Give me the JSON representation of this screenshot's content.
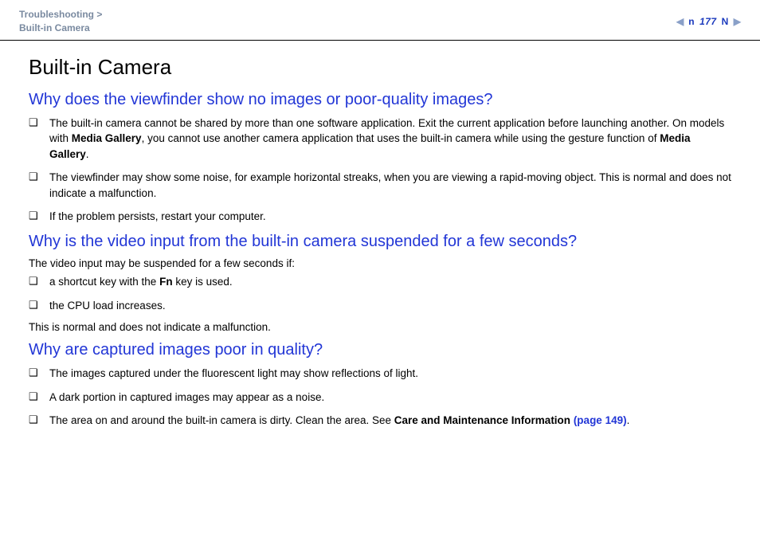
{
  "header": {
    "breadcrumb_section": "Troubleshooting",
    "breadcrumb_sep": " >",
    "breadcrumb_page": "Built-in Camera",
    "page_number": "177",
    "n_marker": "n",
    "N_marker": "N"
  },
  "title": "Built-in Camera",
  "sections": [
    {
      "heading": "Why does the viewfinder show no images or poor-quality images?",
      "items": [
        {
          "pre": "The built-in camera cannot be shared by more than one software application. Exit the current application before launching another. On models with ",
          "b1": "Media Gallery",
          "mid": ", you cannot use another camera application that uses the built-in camera while using the gesture function of ",
          "b2": "Media Gallery",
          "post": "."
        },
        {
          "text": "The viewfinder may show some noise, for example horizontal streaks, when you are viewing a rapid-moving object. This is normal and does not indicate a malfunction."
        },
        {
          "text": "If the problem persists, restart your computer."
        }
      ]
    },
    {
      "heading": "Why is the video input from the built-in camera suspended for a few seconds?",
      "intro": "The video input may be suspended for a few seconds if:",
      "items": [
        {
          "pre": "a shortcut key with the ",
          "b1": "Fn",
          "post": " key is used."
        },
        {
          "text": "the CPU load increases."
        }
      ],
      "outro": "This is normal and does not indicate a malfunction."
    },
    {
      "heading": "Why are captured images poor in quality?",
      "items": [
        {
          "text": "The images captured under the fluorescent light may show reflections of light."
        },
        {
          "text": "A dark portion in captured images may appear as a noise."
        },
        {
          "pre": "The area on and around the built-in camera is dirty. Clean the area. See ",
          "b1": "Care and Maintenance Information ",
          "link": "(page 149)",
          "post": "."
        }
      ]
    }
  ]
}
